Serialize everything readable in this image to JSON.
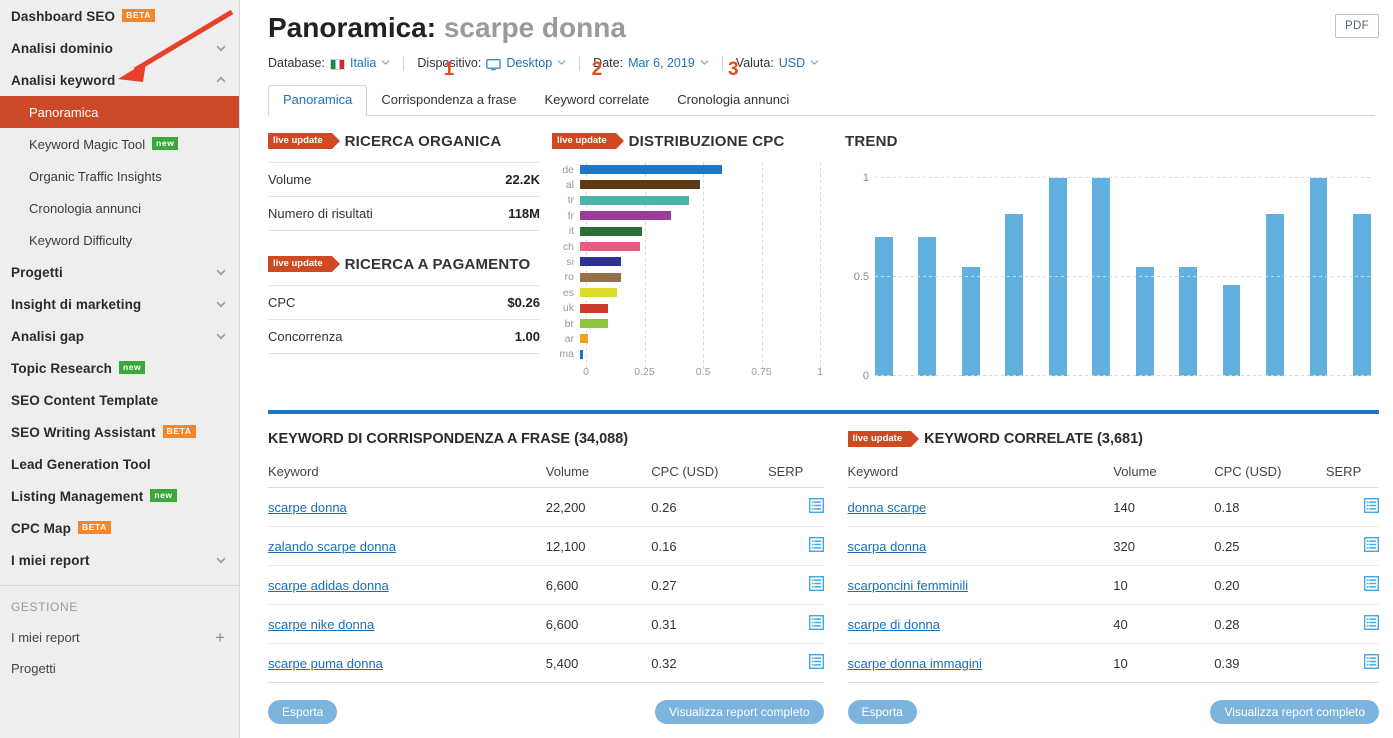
{
  "sidebar": {
    "groups": [
      {
        "label": "Dashboard SEO",
        "badge": "BETA",
        "badge_type": "beta",
        "chevron": ""
      },
      {
        "label": "Analisi dominio",
        "badge": "",
        "badge_type": "",
        "chevron": "down"
      },
      {
        "label": "Analisi keyword",
        "badge": "",
        "badge_type": "",
        "chevron": "up"
      }
    ],
    "sub_items": [
      {
        "label": "Panoramica",
        "badge": "",
        "badge_type": "",
        "active": true
      },
      {
        "label": "Keyword Magic Tool",
        "badge": "new",
        "badge_type": "new",
        "active": false
      },
      {
        "label": "Organic Traffic Insights",
        "badge": "",
        "badge_type": "",
        "active": false
      },
      {
        "label": "Cronologia annunci",
        "badge": "",
        "badge_type": "",
        "active": false
      },
      {
        "label": "Keyword Difficulty",
        "badge": "",
        "badge_type": "",
        "active": false
      }
    ],
    "groups_lower": [
      {
        "label": "Progetti",
        "badge": "",
        "badge_type": "",
        "chevron": "down"
      },
      {
        "label": "Insight di marketing",
        "badge": "",
        "badge_type": "",
        "chevron": "down"
      },
      {
        "label": "Analisi gap",
        "badge": "",
        "badge_type": "",
        "chevron": "down"
      },
      {
        "label": "Topic Research",
        "badge": "new",
        "badge_type": "new",
        "chevron": ""
      },
      {
        "label": "SEO Content Template",
        "badge": "",
        "badge_type": "",
        "chevron": ""
      },
      {
        "label": "SEO Writing Assistant",
        "badge": "BETA",
        "badge_type": "beta",
        "chevron": ""
      },
      {
        "label": "Lead Generation Tool",
        "badge": "",
        "badge_type": "",
        "chevron": ""
      },
      {
        "label": "Listing Management",
        "badge": "new",
        "badge_type": "new",
        "chevron": ""
      },
      {
        "label": "CPC Map",
        "badge": "BETA",
        "badge_type": "beta",
        "chevron": ""
      },
      {
        "label": "I miei report",
        "badge": "",
        "badge_type": "",
        "chevron": "down"
      }
    ],
    "section_label": "GESTIONE",
    "manage_items": [
      {
        "label": "I miei report",
        "action": "+"
      },
      {
        "label": "Progetti",
        "action": ""
      }
    ]
  },
  "header": {
    "title_prefix": "Panoramica:",
    "title_keyword": "scarpe donna",
    "pdf_label": "PDF",
    "filters": [
      {
        "label": "Database:",
        "value": "Italia",
        "icon": "italy-flag-icon"
      },
      {
        "label": "Dispositivo:",
        "value": "Desktop",
        "icon": "monitor-icon"
      },
      {
        "label": "Date:",
        "value": "Mar 6, 2019",
        "icon": ""
      },
      {
        "label": "Valuta:",
        "value": "USD",
        "icon": ""
      }
    ],
    "tabs": [
      {
        "label": "Panoramica",
        "active": true,
        "annotation": ""
      },
      {
        "label": "Corrispondenza a frase",
        "active": false,
        "annotation": "1"
      },
      {
        "label": "Keyword correlate",
        "active": false,
        "annotation": "2"
      },
      {
        "label": "Cronologia annunci",
        "active": false,
        "annotation": "3"
      }
    ]
  },
  "widgets": {
    "live_update_label": "live update",
    "organic": {
      "title": "RICERCA ORGANICA",
      "rows": [
        {
          "label": "Volume",
          "value": "22.2K"
        },
        {
          "label": "Numero di risultati",
          "value": "118M"
        }
      ]
    },
    "paid": {
      "title": "RICERCA A PAGAMENTO",
      "rows": [
        {
          "label": "CPC",
          "value": "$0.26"
        },
        {
          "label": "Concorrenza",
          "value": "1.00"
        }
      ]
    },
    "cpc_title": "DISTRIBUZIONE CPC",
    "trend_title": "TREND"
  },
  "chart_data": [
    {
      "type": "bar",
      "orientation": "horizontal",
      "title": "DISTRIBUZIONE CPC",
      "categories": [
        "de",
        "al",
        "tr",
        "fr",
        "it",
        "ch",
        "si",
        "ro",
        "es",
        "uk",
        "br",
        "ar",
        "ma"
      ],
      "values": [
        0.59,
        0.5,
        0.455,
        0.38,
        0.26,
        0.25,
        0.17,
        0.17,
        0.155,
        0.115,
        0.115,
        0.035,
        0.012
      ],
      "colors": [
        "#1f77c4",
        "#5c3a14",
        "#4cb3ab",
        "#9b3d9b",
        "#2d6e36",
        "#ef5880",
        "#2e3192",
        "#97704a",
        "#dcdb28",
        "#ce3a2c",
        "#8cc63f",
        "#f5a01e",
        "#1f77c4"
      ],
      "xlabel": "",
      "ylabel": "",
      "xlim": [
        0,
        1
      ],
      "xticks": [
        "0",
        "0.25",
        "0.5",
        "0.75",
        "1"
      ],
      "xtick_values": [
        0,
        0.25,
        0.5,
        0.75,
        1
      ],
      "grid": true,
      "legend": "none"
    },
    {
      "type": "bar",
      "orientation": "vertical",
      "title": "TREND",
      "categories": [
        "1",
        "2",
        "3",
        "4",
        "5",
        "6",
        "7",
        "8",
        "9",
        "10",
        "11",
        "12"
      ],
      "values": [
        0.7,
        0.7,
        0.55,
        0.82,
        1.0,
        1.0,
        0.55,
        0.55,
        0.46,
        0.82,
        1.0,
        0.82
      ],
      "color": "#62b0e0",
      "xlabel": "",
      "ylabel": "",
      "ylim": [
        0,
        1
      ],
      "yticks": [
        "0",
        "0.5",
        "1"
      ],
      "ytick_values": [
        0,
        0.5,
        1
      ],
      "grid": true,
      "legend": "none"
    }
  ],
  "tables": [
    {
      "title": "KEYWORD DI CORRISPONDENZA A FRASE (34,088)",
      "has_live_badge": false,
      "columns": [
        "Keyword",
        "Volume",
        "CPC (USD)",
        "SERP"
      ],
      "rows": [
        {
          "keyword": "scarpe donna",
          "volume": "22,200",
          "cpc": "0.26",
          "serp": "serp-icon"
        },
        {
          "keyword": "zalando scarpe donna",
          "volume": "12,100",
          "cpc": "0.16",
          "serp": "serp-icon"
        },
        {
          "keyword": "scarpe adidas donna",
          "volume": "6,600",
          "cpc": "0.27",
          "serp": "serp-icon"
        },
        {
          "keyword": "scarpe nike donna",
          "volume": "6,600",
          "cpc": "0.31",
          "serp": "serp-icon"
        },
        {
          "keyword": "scarpe puma donna",
          "volume": "5,400",
          "cpc": "0.32",
          "serp": "serp-icon"
        }
      ],
      "export_label": "Esporta",
      "full_report_label": "Visualizza report completo"
    },
    {
      "title": "KEYWORD CORRELATE (3,681)",
      "has_live_badge": true,
      "columns": [
        "Keyword",
        "Volume",
        "CPC (USD)",
        "SERP"
      ],
      "rows": [
        {
          "keyword": "donna scarpe",
          "volume": "140",
          "cpc": "0.18",
          "serp": "serp-icon"
        },
        {
          "keyword": "scarpa donna",
          "volume": "320",
          "cpc": "0.25",
          "serp": "serp-icon"
        },
        {
          "keyword": "scarponcini femminili",
          "volume": "10",
          "cpc": "0.20",
          "serp": "serp-icon"
        },
        {
          "keyword": "scarpe di donna",
          "volume": "40",
          "cpc": "0.28",
          "serp": "serp-icon"
        },
        {
          "keyword": "scarpe donna immagini",
          "volume": "10",
          "cpc": "0.39",
          "serp": "serp-icon"
        }
      ],
      "export_label": "Esporta",
      "full_report_label": "Visualizza report completo"
    }
  ],
  "colors": {
    "accent_orange": "#cc4928",
    "accent_blue": "#1a73b7",
    "rule_blue": "#1b79c0",
    "annotation_red": "#e34d21",
    "badge_beta": "#f3862c",
    "badge_new": "#3aa93a"
  }
}
